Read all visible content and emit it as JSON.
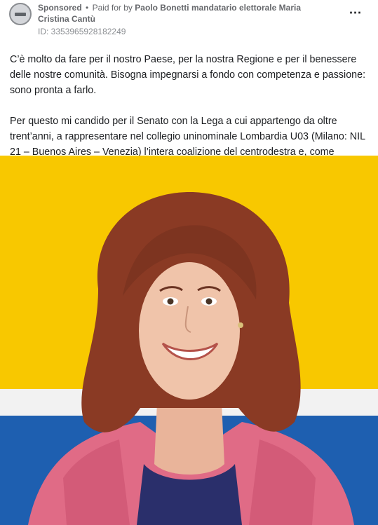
{
  "post": {
    "sponsored_label": "Sponsored",
    "separator": "•",
    "paid_for_prefix": "Paid for by",
    "payer": "Paolo Bonetti mandatario elettorale Maria Cristina Cantù",
    "ad_id": "ID: 3353965928182249",
    "more_icon": "ellipsis-icon",
    "more_label": "⋯",
    "paragraphs": [
      "C’è molto da fare per il nostro Paese, per la nostra Regione e per il benessere delle nostre comunità. Bisogna impegnarsi a fondo con competenza e passione: sono pronta a farlo.",
      "Per questo mi candido per il Senato con la Lega a cui appartengo da oltre trent’anni, a rappresentare nel collegio uninominale Lombardia U03 (Milano: NIL 21 – Buenos Aires – Venezia) l’intera coalizione del centrodestra e, come capolista…"
    ]
  },
  "colors": {
    "yellow": "#f8c800",
    "white": "#f2f2f2",
    "blue": "#1e5fb0",
    "text": "#1c1e21",
    "muted": "#65676b"
  }
}
